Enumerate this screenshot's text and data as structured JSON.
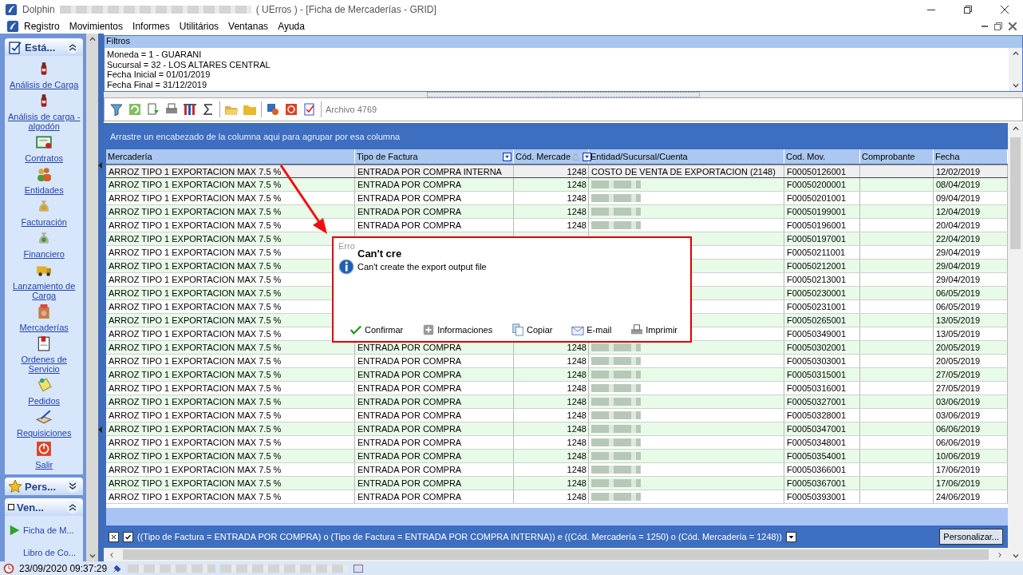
{
  "window": {
    "app": "Dolphin",
    "title": "( UErros ) - [Ficha de Mercaderías - GRID]"
  },
  "menu": [
    {
      "label": "Registro"
    },
    {
      "label": "Movimientos"
    },
    {
      "label": "Informes"
    },
    {
      "label": "Utilitários"
    },
    {
      "label": "Ventanas"
    },
    {
      "label": "Ayuda"
    }
  ],
  "sidebar": {
    "groups": [
      {
        "title": "Está...",
        "expanded": true,
        "items": [
          {
            "label": "Análisis de Carga"
          },
          {
            "label": "Análisis de carga - algodón"
          },
          {
            "label": "Contratos"
          },
          {
            "label": "Entidades"
          },
          {
            "label": "Facturación"
          },
          {
            "label": "Financiero"
          },
          {
            "label": "Lanzamiento de Carga"
          },
          {
            "label": "Mercaderías"
          },
          {
            "label": "Ordenes de Servicio"
          },
          {
            "label": "Pedidos"
          },
          {
            "label": "Requisiciones"
          },
          {
            "label": "Salir"
          }
        ]
      },
      {
        "title": "Pers...",
        "expanded": false
      },
      {
        "title": "Ven...",
        "expanded": true,
        "items": [
          {
            "label": "Ficha de M...",
            "kind": "play"
          },
          {
            "label": "Libro de Co...",
            "kind": "plain"
          }
        ]
      }
    ]
  },
  "filters": {
    "title": "Filtros",
    "lines": [
      "Moneda = 1 - GUARANI",
      "Sucursal = 32 - LOS ALTARES CENTRAL",
      "Fecha Inicial = 01/01/2019",
      "Fecha Final = 31/12/2019"
    ]
  },
  "toolbar": {
    "file_label": "Archivo 4769"
  },
  "grid": {
    "group_hint": "Arrastre un encabezado de la columna aqui para agrupar por esa columna",
    "columns": [
      {
        "label": "Mercadería",
        "filter": false,
        "sorted": false
      },
      {
        "label": "Tipo de Factura",
        "filter": true,
        "sorted": false
      },
      {
        "label": "Cód. Mercade",
        "filter": true,
        "sorted": true
      },
      {
        "label": "Entidad/Sucursal/Cuenta",
        "filter": false,
        "sorted": false
      },
      {
        "label": "Cod. Mov.",
        "filter": false,
        "sorted": false
      },
      {
        "label": "Comprobante",
        "filter": false,
        "sorted": false
      },
      {
        "label": "Fecha",
        "filter": false,
        "sorted": false
      }
    ],
    "rows": [
      {
        "mercaderia": "ARROZ TIPO 1 EXPORTACION MAX 7.5 %",
        "tipo": "ENTRADA POR COMPRA INTERNA",
        "cod": "1248",
        "entidad": "COSTO DE VENTA DE EXPORTACION (2148)",
        "cod_mov": "F00050126001",
        "fecha": "12/02/2019",
        "selected": true,
        "redacted": false
      },
      {
        "mercaderia": "ARROZ TIPO 1 EXPORTACION MAX 7.5 %",
        "tipo": "ENTRADA POR COMPRA",
        "cod": "1248",
        "cod_mov": "F00050200001",
        "fecha": "08/04/2019",
        "selected": false,
        "redacted": true
      },
      {
        "mercaderia": "ARROZ TIPO 1 EXPORTACION MAX 7.5 %",
        "tipo": "ENTRADA POR COMPRA",
        "cod": "1248",
        "cod_mov": "F00050201001",
        "fecha": "09/04/2019",
        "selected": false,
        "redacted": true
      },
      {
        "mercaderia": "ARROZ TIPO 1 EXPORTACION MAX 7.5 %",
        "tipo": "ENTRADA POR COMPRA",
        "cod": "1248",
        "cod_mov": "F00050199001",
        "fecha": "12/04/2019",
        "selected": false,
        "redacted": true
      },
      {
        "mercaderia": "ARROZ TIPO 1 EXPORTACION MAX 7.5 %",
        "tipo": "ENTRADA POR COMPRA",
        "cod": "1248",
        "cod_mov": "F00050196001",
        "fecha": "20/04/2019",
        "selected": false,
        "redacted": true
      },
      {
        "mercaderia": "ARROZ TIPO 1 EXPORTACION MAX 7.5 %",
        "cod_mov": "F00050197001",
        "fecha": "22/04/2019",
        "selected": false,
        "redacted": false
      },
      {
        "mercaderia": "ARROZ TIPO 1 EXPORTACION MAX 7.5 %",
        "cod_mov": "F00050211001",
        "fecha": "29/04/2019",
        "selected": false,
        "redacted": false
      },
      {
        "mercaderia": "ARROZ TIPO 1 EXPORTACION MAX 7.5 %",
        "cod_mov": "F00050212001",
        "fecha": "29/04/2019",
        "selected": false,
        "redacted": false
      },
      {
        "mercaderia": "ARROZ TIPO 1 EXPORTACION MAX 7.5 %",
        "cod_mov": "F00050213001",
        "fecha": "29/04/2019",
        "selected": false,
        "redacted": false
      },
      {
        "mercaderia": "ARROZ TIPO 1 EXPORTACION MAX 7.5 %",
        "cod_mov": "F00050230001",
        "fecha": "06/05/2019",
        "selected": false,
        "redacted": false
      },
      {
        "mercaderia": "ARROZ TIPO 1 EXPORTACION MAX 7.5 %",
        "cod_mov": "F00050231001",
        "fecha": "06/05/2019",
        "selected": false,
        "redacted": false
      },
      {
        "mercaderia": "ARROZ TIPO 1 EXPORTACION MAX 7.5 %",
        "cod_mov": "F00050265001",
        "fecha": "13/05/2019",
        "selected": false,
        "redacted": false
      },
      {
        "mercaderia": "ARROZ TIPO 1 EXPORTACION MAX 7.5 %",
        "cod_mov": "F00050349001",
        "fecha": "13/05/2019",
        "selected": false,
        "redacted": false
      },
      {
        "mercaderia": "ARROZ TIPO 1 EXPORTACION MAX 7.5 %",
        "tipo": "ENTRADA POR COMPRA",
        "cod": "1248",
        "cod_mov": "F00050302001",
        "fecha": "20/05/2019",
        "selected": false,
        "redacted": true
      },
      {
        "mercaderia": "ARROZ TIPO 1 EXPORTACION MAX 7.5 %",
        "tipo": "ENTRADA POR COMPRA",
        "cod": "1248",
        "cod_mov": "F00050303001",
        "fecha": "20/05/2019",
        "selected": false,
        "redacted": true
      },
      {
        "mercaderia": "ARROZ TIPO 1 EXPORTACION MAX 7.5 %",
        "tipo": "ENTRADA POR COMPRA",
        "cod": "1248",
        "cod_mov": "F00050315001",
        "fecha": "27/05/2019",
        "selected": false,
        "redacted": true
      },
      {
        "mercaderia": "ARROZ TIPO 1 EXPORTACION MAX 7.5 %",
        "tipo": "ENTRADA POR COMPRA",
        "cod": "1248",
        "cod_mov": "F00050316001",
        "fecha": "27/05/2019",
        "selected": false,
        "redacted": true
      },
      {
        "mercaderia": "ARROZ TIPO 1 EXPORTACION MAX 7.5 %",
        "tipo": "ENTRADA POR COMPRA",
        "cod": "1248",
        "cod_mov": "F00050327001",
        "fecha": "03/06/2019",
        "selected": false,
        "redacted": true
      },
      {
        "mercaderia": "ARROZ TIPO 1 EXPORTACION MAX 7.5 %",
        "tipo": "ENTRADA POR COMPRA",
        "cod": "1248",
        "cod_mov": "F00050328001",
        "fecha": "03/06/2019",
        "selected": false,
        "redacted": true
      },
      {
        "mercaderia": "ARROZ TIPO 1 EXPORTACION MAX 7.5 %",
        "tipo": "ENTRADA POR COMPRA",
        "cod": "1248",
        "cod_mov": "F00050347001",
        "fecha": "06/06/2019",
        "selected": false,
        "redacted": true
      },
      {
        "mercaderia": "ARROZ TIPO 1 EXPORTACION MAX 7.5 %",
        "tipo": "ENTRADA POR COMPRA",
        "cod": "1248",
        "cod_mov": "F00050348001",
        "fecha": "06/06/2019",
        "selected": false,
        "redacted": true
      },
      {
        "mercaderia": "ARROZ TIPO 1 EXPORTACION MAX 7.5 %",
        "tipo": "ENTRADA POR COMPRA",
        "cod": "1248",
        "cod_mov": "F00050354001",
        "fecha": "10/06/2019",
        "selected": false,
        "redacted": true
      },
      {
        "mercaderia": "ARROZ TIPO 1 EXPORTACION MAX 7.5 %",
        "tipo": "ENTRADA POR COMPRA",
        "cod": "1248",
        "cod_mov": "F00050366001",
        "fecha": "17/06/2019",
        "selected": false,
        "redacted": true
      },
      {
        "mercaderia": "ARROZ TIPO 1 EXPORTACION MAX 7.5 %",
        "tipo": "ENTRADA POR COMPRA",
        "cod": "1248",
        "cod_mov": "F00050367001",
        "fecha": "17/06/2019",
        "selected": false,
        "redacted": true
      },
      {
        "mercaderia": "ARROZ TIPO 1 EXPORTACION MAX 7.5 %",
        "tipo": "ENTRADA POR COMPRA",
        "cod": "1248",
        "cod_mov": "F00050393001",
        "fecha": "24/06/2019",
        "selected": false,
        "redacted": true
      }
    ]
  },
  "filter_bar": {
    "checked": true,
    "expression": "((Tipo de Factura = ENTRADA POR COMPRA) o (Tipo de Factura = ENTRADA POR COMPRA INTERNA)) e ((Cód. Mercadería = 1250) o (Cód. Mercadería = 1248))",
    "button": "Personalizar..."
  },
  "status_bar": {
    "datetime": "23/09/2020 09:37:29"
  },
  "dialog": {
    "title": "Erro",
    "heading": "Can't cre",
    "message": "Can't create the export output file",
    "buttons": [
      {
        "label": "Confirmar"
      },
      {
        "label": "Informaciones"
      },
      {
        "label": "Copiar"
      },
      {
        "label": "E-mail"
      },
      {
        "label": "Imprimir"
      }
    ]
  }
}
